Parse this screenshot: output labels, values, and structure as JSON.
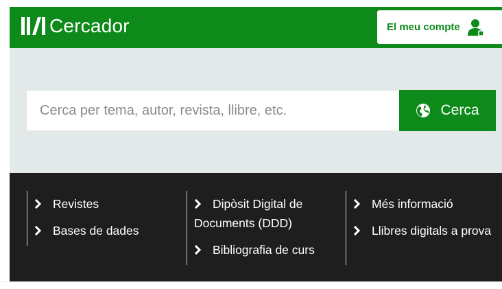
{
  "header": {
    "title": "Cercador",
    "account_label": "El meu compte"
  },
  "search": {
    "placeholder": "Cerca per tema, autor, revista, llibre, etc.",
    "button_label": "Cerca"
  },
  "links": {
    "col1": [
      "Revistes",
      "Bases de dades"
    ],
    "col2": [
      "Dipòsit Digital de Documents (DDD)",
      "Bibliografia de curs"
    ],
    "col3": [
      "Més informació",
      "Llibres digitals a prova"
    ]
  },
  "colors": {
    "brand_green": "#0e8a1a",
    "panel_dark": "#1e1e1e",
    "band_grey": "#e3e8e9"
  }
}
